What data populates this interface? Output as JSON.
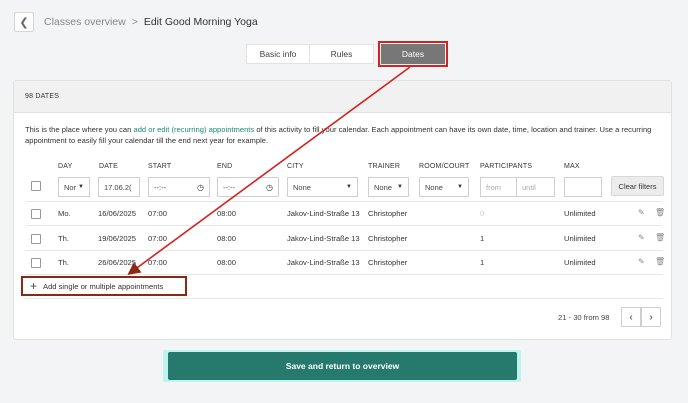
{
  "header": {
    "back_icon": "chevron-left-icon",
    "breadcrumb_parent": "Classes overview",
    "separator": ">",
    "current": "Edit Good Morning Yoga"
  },
  "tabs": [
    {
      "label": "Basic info"
    },
    {
      "label": "Rules"
    },
    {
      "label": "Dates",
      "active": true
    }
  ],
  "card": {
    "title": "98 DATES",
    "description_before": "This is the place where you can ",
    "description_link": "add or edit (recurring) appointments",
    "description_after": " of this activity to fill your calendar. Each appointment can have its own date, time, location and trainer. Use a recurring appointment to easily fill your calendar till the end next year for example.",
    "columns": [
      "DAY",
      "DATE",
      "START",
      "END",
      "CITY",
      "TRAINER",
      "ROOM/COURT",
      "PARTICIPANTS",
      "MAX"
    ],
    "filters": {
      "day": "Nor",
      "date": "17.06.2(",
      "start": "--:--",
      "end": "--:--",
      "city": "None",
      "trainer": "None",
      "room": "None",
      "participants_from_placeholder": "from",
      "participants_until_placeholder": "until",
      "max": ""
    },
    "clear_filters": "Clear filters",
    "rows": [
      {
        "day": "Mo.",
        "date": "16/06/2025",
        "start": "07:00",
        "end": "08:00",
        "city": "Jakov-Lind-Straße 13",
        "trainer": "Christopher",
        "participants": "0",
        "max": "Unlimited"
      },
      {
        "day": "Th.",
        "date": "19/06/2025",
        "start": "07:00",
        "end": "08:00",
        "city": "Jakov-Lind-Straße 13",
        "trainer": "Christopher",
        "participants": "1",
        "max": "Unlimited"
      },
      {
        "day": "Th.",
        "date": "26/06/2025",
        "start": "07:00",
        "end": "08:00",
        "city": "Jakov-Lind-Straße 13",
        "trainer": "Christopher",
        "participants": "1",
        "max": "Unlimited"
      }
    ],
    "add_label": "Add single or multiple appointments",
    "pagination": "21 - 30 from 98"
  },
  "save_button": "Save and return to overview",
  "colors": {
    "accent": "#257a6d",
    "highlight_red": "#d42121",
    "tab_active": "#777777"
  }
}
